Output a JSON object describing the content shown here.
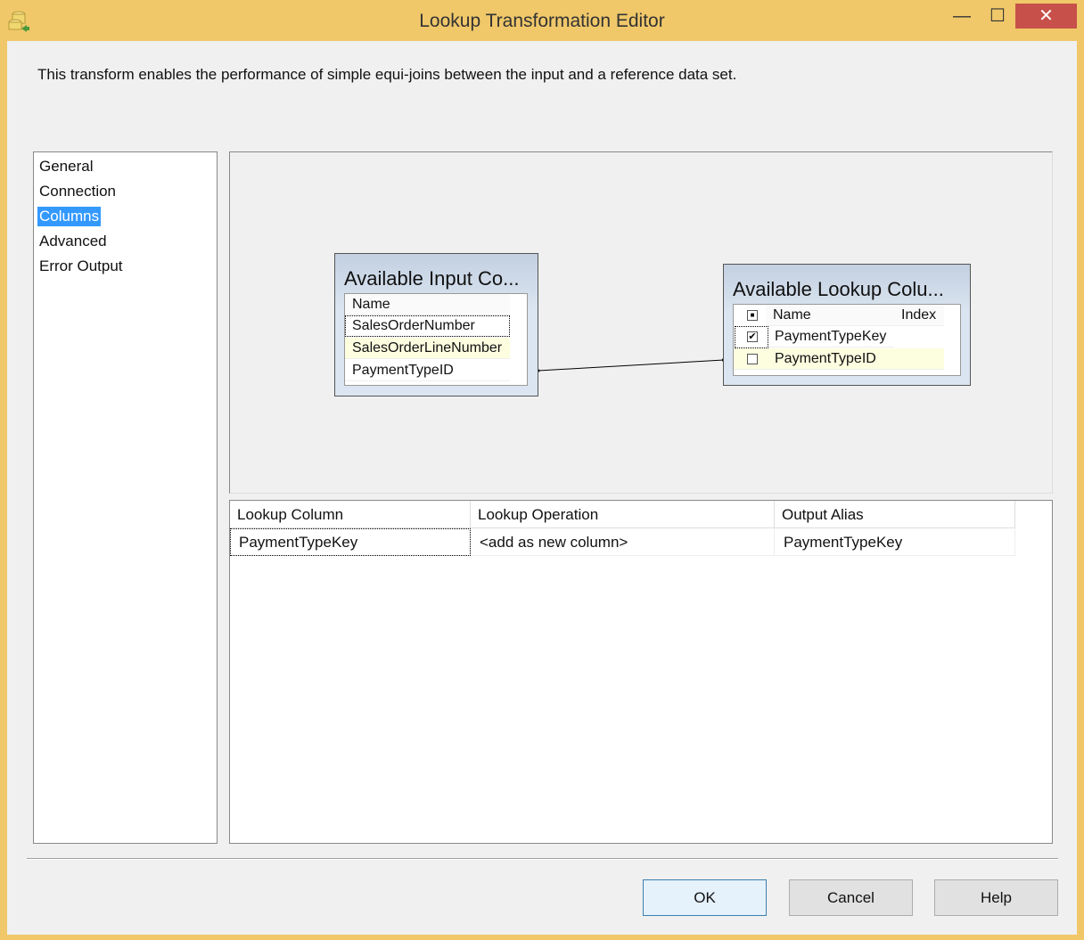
{
  "window": {
    "title": "Lookup Transformation Editor",
    "minimize": "—",
    "maximize": "☐",
    "close": "✕"
  },
  "description": "This transform enables the performance of simple equi-joins between the input and a reference data set.",
  "nav": [
    "General",
    "Connection",
    "Columns",
    "Advanced",
    "Error Output"
  ],
  "input_box": {
    "title": "Available Input Co...",
    "header": "Name",
    "rows": [
      "SalesOrderNumber",
      "SalesOrderLineNumber",
      "PaymentTypeID"
    ]
  },
  "lookup_box": {
    "title": "Available Lookup Colu...",
    "headers": [
      "Name",
      "Index"
    ],
    "rows": [
      {
        "name": "PaymentTypeKey",
        "checked": true,
        "check": "✔"
      },
      {
        "name": "PaymentTypeID",
        "checked": false,
        "check": ""
      }
    ],
    "header_check": "■"
  },
  "grid": {
    "headers": [
      "Lookup Column",
      "Lookup Operation",
      "Output Alias"
    ],
    "rows": [
      [
        "PaymentTypeKey",
        "<add as new column>",
        "PaymentTypeKey"
      ]
    ]
  },
  "buttons": {
    "ok": "OK",
    "cancel": "Cancel",
    "help": "Help"
  }
}
